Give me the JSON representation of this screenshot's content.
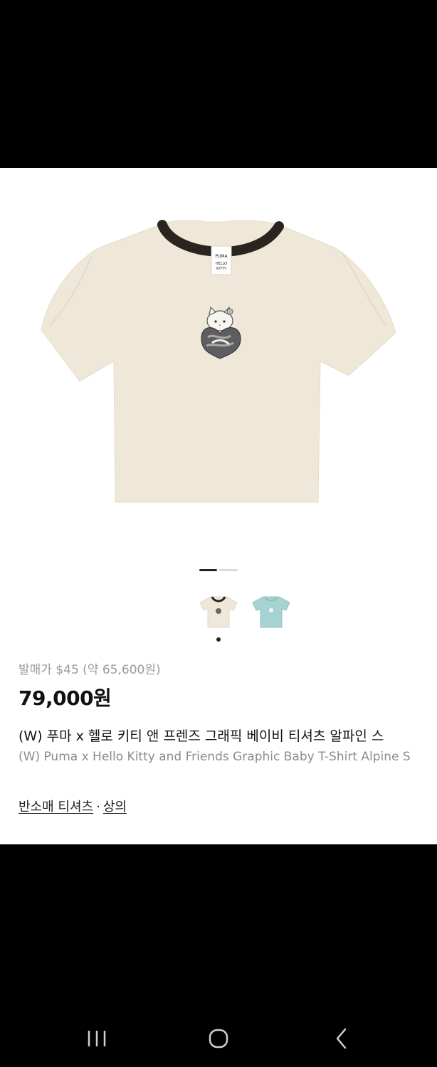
{
  "product": {
    "release_price": "발매가 $45 (약 65,600원)",
    "price": "79,000원",
    "name_ko": "(W) 푸마 x 헬로 키티 앤 프렌즈 그래픽 베이비 티셔츠 알파인 스",
    "name_en": "(W) Puma x Hello Kitty and Friends Graphic Baby T-Shirt Alpine S",
    "hero_image": "beige-tshirt-with-hello-kitty-heart-graphic",
    "carousel": {
      "count": 2,
      "active_index": 0
    }
  },
  "thumbnails": [
    {
      "color": "#efe8d9",
      "alt": "beige-tshirt-thumbnail",
      "selected": true
    },
    {
      "color": "#a8d3d3",
      "alt": "mint-tshirt-thumbnail",
      "selected": false
    }
  ],
  "category": {
    "primary": "반소매 티셔츠",
    "separator": "·",
    "secondary": "상의"
  },
  "system_nav": {
    "recent_icon": "recent-apps-icon",
    "home_icon": "home-icon",
    "back_icon": "back-icon"
  },
  "colors": {
    "shirt": "#efe8d9",
    "collar": "#2a241f",
    "thumbnail_mint": "#a8d3d3"
  }
}
